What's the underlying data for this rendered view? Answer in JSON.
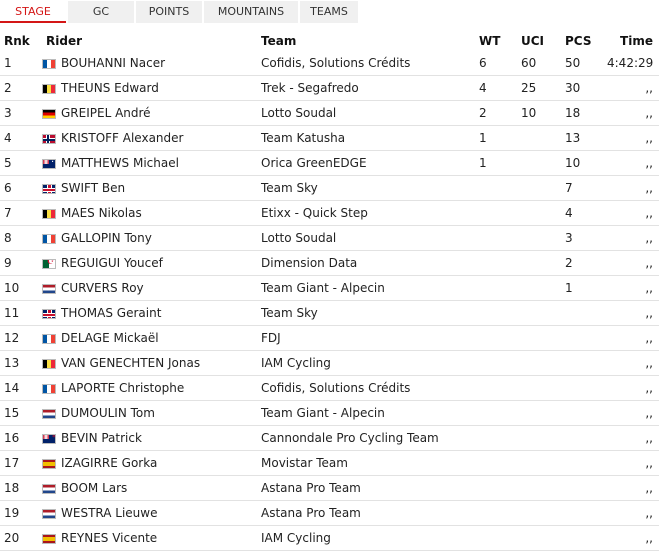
{
  "tabs": [
    {
      "label": "STAGE",
      "active": true
    },
    {
      "label": "GC",
      "active": false
    },
    {
      "label": "POINTS",
      "active": false
    },
    {
      "label": "MOUNTAINS",
      "active": false
    },
    {
      "label": "TEAMS",
      "active": false
    }
  ],
  "table": {
    "headers": {
      "rnk": "Rnk",
      "rider": "Rider",
      "team": "Team",
      "wt": "WT",
      "uci": "UCI",
      "pcs": "PCS",
      "time": "Time"
    },
    "rows": [
      {
        "rnk": "1",
        "flag": "FR",
        "rider": "BOUHANNI Nacer",
        "team": "Cofidis, Solutions Crédits",
        "wt": "6",
        "uci": "60",
        "pcs": "50",
        "time": "4:42:29"
      },
      {
        "rnk": "2",
        "flag": "BE",
        "rider": "THEUNS Edward",
        "team": "Trek - Segafredo",
        "wt": "4",
        "uci": "25",
        "pcs": "30",
        "time": ",,"
      },
      {
        "rnk": "3",
        "flag": "DE",
        "rider": "GREIPEL André",
        "team": "Lotto Soudal",
        "wt": "2",
        "uci": "10",
        "pcs": "18",
        "time": ",,"
      },
      {
        "rnk": "4",
        "flag": "NO",
        "rider": "KRISTOFF Alexander",
        "team": "Team Katusha",
        "wt": "1",
        "uci": "",
        "pcs": "13",
        "time": ",,"
      },
      {
        "rnk": "5",
        "flag": "AU",
        "rider": "MATTHEWS Michael",
        "team": "Orica GreenEDGE",
        "wt": "1",
        "uci": "",
        "pcs": "10",
        "time": ",,"
      },
      {
        "rnk": "6",
        "flag": "GB",
        "rider": "SWIFT Ben",
        "team": "Team Sky",
        "wt": "",
        "uci": "",
        "pcs": "7",
        "time": ",,"
      },
      {
        "rnk": "7",
        "flag": "BE",
        "rider": "MAES Nikolas",
        "team": "Etixx - Quick Step",
        "wt": "",
        "uci": "",
        "pcs": "4",
        "time": ",,"
      },
      {
        "rnk": "8",
        "flag": "FR",
        "rider": "GALLOPIN Tony",
        "team": "Lotto Soudal",
        "wt": "",
        "uci": "",
        "pcs": "3",
        "time": ",,"
      },
      {
        "rnk": "9",
        "flag": "DZ",
        "rider": "REGUIGUI Youcef",
        "team": "Dimension Data",
        "wt": "",
        "uci": "",
        "pcs": "2",
        "time": ",,"
      },
      {
        "rnk": "10",
        "flag": "NL",
        "rider": "CURVERS Roy",
        "team": "Team Giant - Alpecin",
        "wt": "",
        "uci": "",
        "pcs": "1",
        "time": ",,"
      },
      {
        "rnk": "11",
        "flag": "GB",
        "rider": "THOMAS Geraint",
        "team": "Team Sky",
        "wt": "",
        "uci": "",
        "pcs": "",
        "time": ",,"
      },
      {
        "rnk": "12",
        "flag": "FR",
        "rider": "DELAGE Mickaël",
        "team": "FDJ",
        "wt": "",
        "uci": "",
        "pcs": "",
        "time": ",,"
      },
      {
        "rnk": "13",
        "flag": "BE",
        "rider": "VAN GENECHTEN Jonas",
        "team": "IAM Cycling",
        "wt": "",
        "uci": "",
        "pcs": "",
        "time": ",,"
      },
      {
        "rnk": "14",
        "flag": "FR",
        "rider": "LAPORTE Christophe",
        "team": "Cofidis, Solutions Crédits",
        "wt": "",
        "uci": "",
        "pcs": "",
        "time": ",,"
      },
      {
        "rnk": "15",
        "flag": "NL",
        "rider": "DUMOULIN Tom",
        "team": "Team Giant - Alpecin",
        "wt": "",
        "uci": "",
        "pcs": "",
        "time": ",,"
      },
      {
        "rnk": "16",
        "flag": "NZ",
        "rider": "BEVIN Patrick",
        "team": "Cannondale Pro Cycling Team",
        "wt": "",
        "uci": "",
        "pcs": "",
        "time": ",,"
      },
      {
        "rnk": "17",
        "flag": "ES",
        "rider": "IZAGIRRE Gorka",
        "team": "Movistar Team",
        "wt": "",
        "uci": "",
        "pcs": "",
        "time": ",,"
      },
      {
        "rnk": "18",
        "flag": "NL",
        "rider": "BOOM Lars",
        "team": "Astana Pro Team",
        "wt": "",
        "uci": "",
        "pcs": "",
        "time": ",,"
      },
      {
        "rnk": "19",
        "flag": "NL",
        "rider": "WESTRA Lieuwe",
        "team": "Astana Pro Team",
        "wt": "",
        "uci": "",
        "pcs": "",
        "time": ",,"
      },
      {
        "rnk": "20",
        "flag": "ES",
        "rider": "REYNES Vicente",
        "team": "IAM Cycling",
        "wt": "",
        "uci": "",
        "pcs": "",
        "time": ",,"
      }
    ]
  }
}
